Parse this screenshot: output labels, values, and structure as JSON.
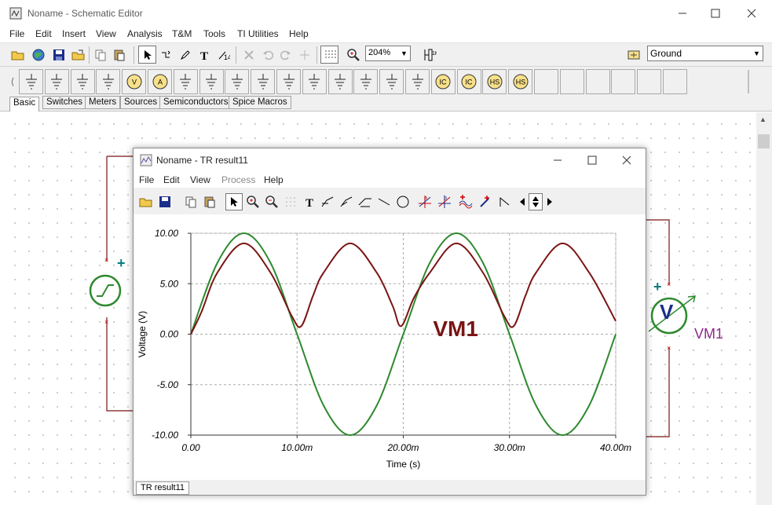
{
  "window": {
    "title": "Noname - Schematic Editor"
  },
  "menu": [
    "File",
    "Edit",
    "Insert",
    "View",
    "Analysis",
    "T&M",
    "Tools",
    "TI Utilities",
    "Help"
  ],
  "toolbar": {
    "zoom_value": "204%",
    "ground_select": "Ground",
    "icons": [
      "new-icon",
      "open-icon",
      "save-icon",
      "open-folder-icon",
      "copy-icon",
      "paste-icon",
      "select-arrow-icon",
      "wire-icon",
      "pen-icon",
      "text-icon",
      "delete-icon",
      "undo-icon",
      "redo-icon",
      "pin-icon",
      "grid-icon",
      "zoom-icon",
      "label-icon",
      "ground-icon"
    ]
  },
  "component_tabs": [
    "Basic",
    "Switches",
    "Meters",
    "Sources",
    "Semiconductors",
    "Spice Macros"
  ],
  "component_bar": {
    "items": [
      {
        "icon": "ground-symbol-icon",
        "label": ""
      },
      {
        "icon": "voltage-source-icon",
        "label": ""
      },
      {
        "icon": "battery-icon",
        "label": ""
      },
      {
        "icon": "current-source-icon",
        "label": ""
      },
      {
        "icon": "voltmeter-icon",
        "label": "V"
      },
      {
        "icon": "ammeter-icon",
        "label": "A"
      },
      {
        "icon": "resistor-icon",
        "label": ""
      },
      {
        "icon": "potentiometer-icon",
        "label": ""
      },
      {
        "icon": "capacitor-icon",
        "label": ""
      },
      {
        "icon": "inductor-icon",
        "label": ""
      },
      {
        "icon": "coupled-inductor-icon",
        "label": ""
      },
      {
        "icon": "transformer-icon",
        "label": ""
      },
      {
        "icon": "transformer2-icon",
        "label": ""
      },
      {
        "icon": "switch-icon",
        "label": ""
      },
      {
        "icon": "varistor-icon",
        "label": ""
      },
      {
        "icon": "diode-icon",
        "label": ""
      },
      {
        "icon": "ic-source-icon",
        "label": "IC"
      },
      {
        "icon": "ic-source2-icon",
        "label": "IC"
      },
      {
        "icon": "hs-source-icon",
        "label": "HS"
      },
      {
        "icon": "hs-source2-icon",
        "label": "HS"
      }
    ]
  },
  "schematic": {
    "voltmeter_label": "VM1",
    "voltmeter_symbol": "V",
    "plus_sign": "+"
  },
  "child_window": {
    "title": "Noname - TR result11",
    "menu": [
      {
        "label": "File",
        "enabled": true
      },
      {
        "label": "Edit",
        "enabled": true
      },
      {
        "label": "View",
        "enabled": true
      },
      {
        "label": "Process",
        "enabled": false
      },
      {
        "label": "Help",
        "enabled": true
      }
    ],
    "tab": "TR result11",
    "colors": {
      "vm1_trace": "#7a1414",
      "source_trace": "#2f8a2f"
    }
  },
  "chart_data": {
    "type": "line",
    "xlabel": "Time (s)",
    "ylabel": "Voltage (V)",
    "xlim": [
      0,
      0.04
    ],
    "ylim": [
      -10,
      10
    ],
    "x_ticks": [
      "0.00",
      "10.00m",
      "20.00m",
      "30.00m",
      "40.00m"
    ],
    "y_ticks": [
      "10.00",
      "5.00",
      "0.00",
      "-5.00",
      "-10.00"
    ],
    "annotation": "VM1",
    "grid": true,
    "series": [
      {
        "name": "",
        "color": "#2f8a2f",
        "x": [
          0,
          0.0025,
          0.005,
          0.0075,
          0.01,
          0.0125,
          0.015,
          0.0175,
          0.02,
          0.0225,
          0.025,
          0.0275,
          0.03,
          0.0325,
          0.035,
          0.0375,
          0.04
        ],
        "values": [
          0,
          7.07,
          10,
          7.07,
          0,
          -7.07,
          -10,
          -7.07,
          0,
          7.07,
          10,
          7.07,
          0,
          -7.07,
          -10,
          -7.07,
          0
        ]
      },
      {
        "name": "VM1",
        "color": "#7a1414",
        "x": [
          0,
          0.001,
          0.0025,
          0.005,
          0.0075,
          0.0095,
          0.0104,
          0.0115,
          0.0125,
          0.015,
          0.0175,
          0.019,
          0.0198,
          0.021,
          0.0225,
          0.025,
          0.0275,
          0.0295,
          0.0304,
          0.0315,
          0.0325,
          0.035,
          0.0375,
          0.04
        ],
        "values": [
          0,
          2.2,
          6.1,
          9.0,
          6.1,
          1.8,
          0.8,
          3.8,
          6.1,
          9.0,
          6.1,
          2.8,
          0.8,
          3.6,
          6.1,
          9.0,
          6.1,
          1.8,
          0.8,
          3.8,
          6.1,
          9.0,
          6.1,
          1.3
        ]
      }
    ]
  }
}
